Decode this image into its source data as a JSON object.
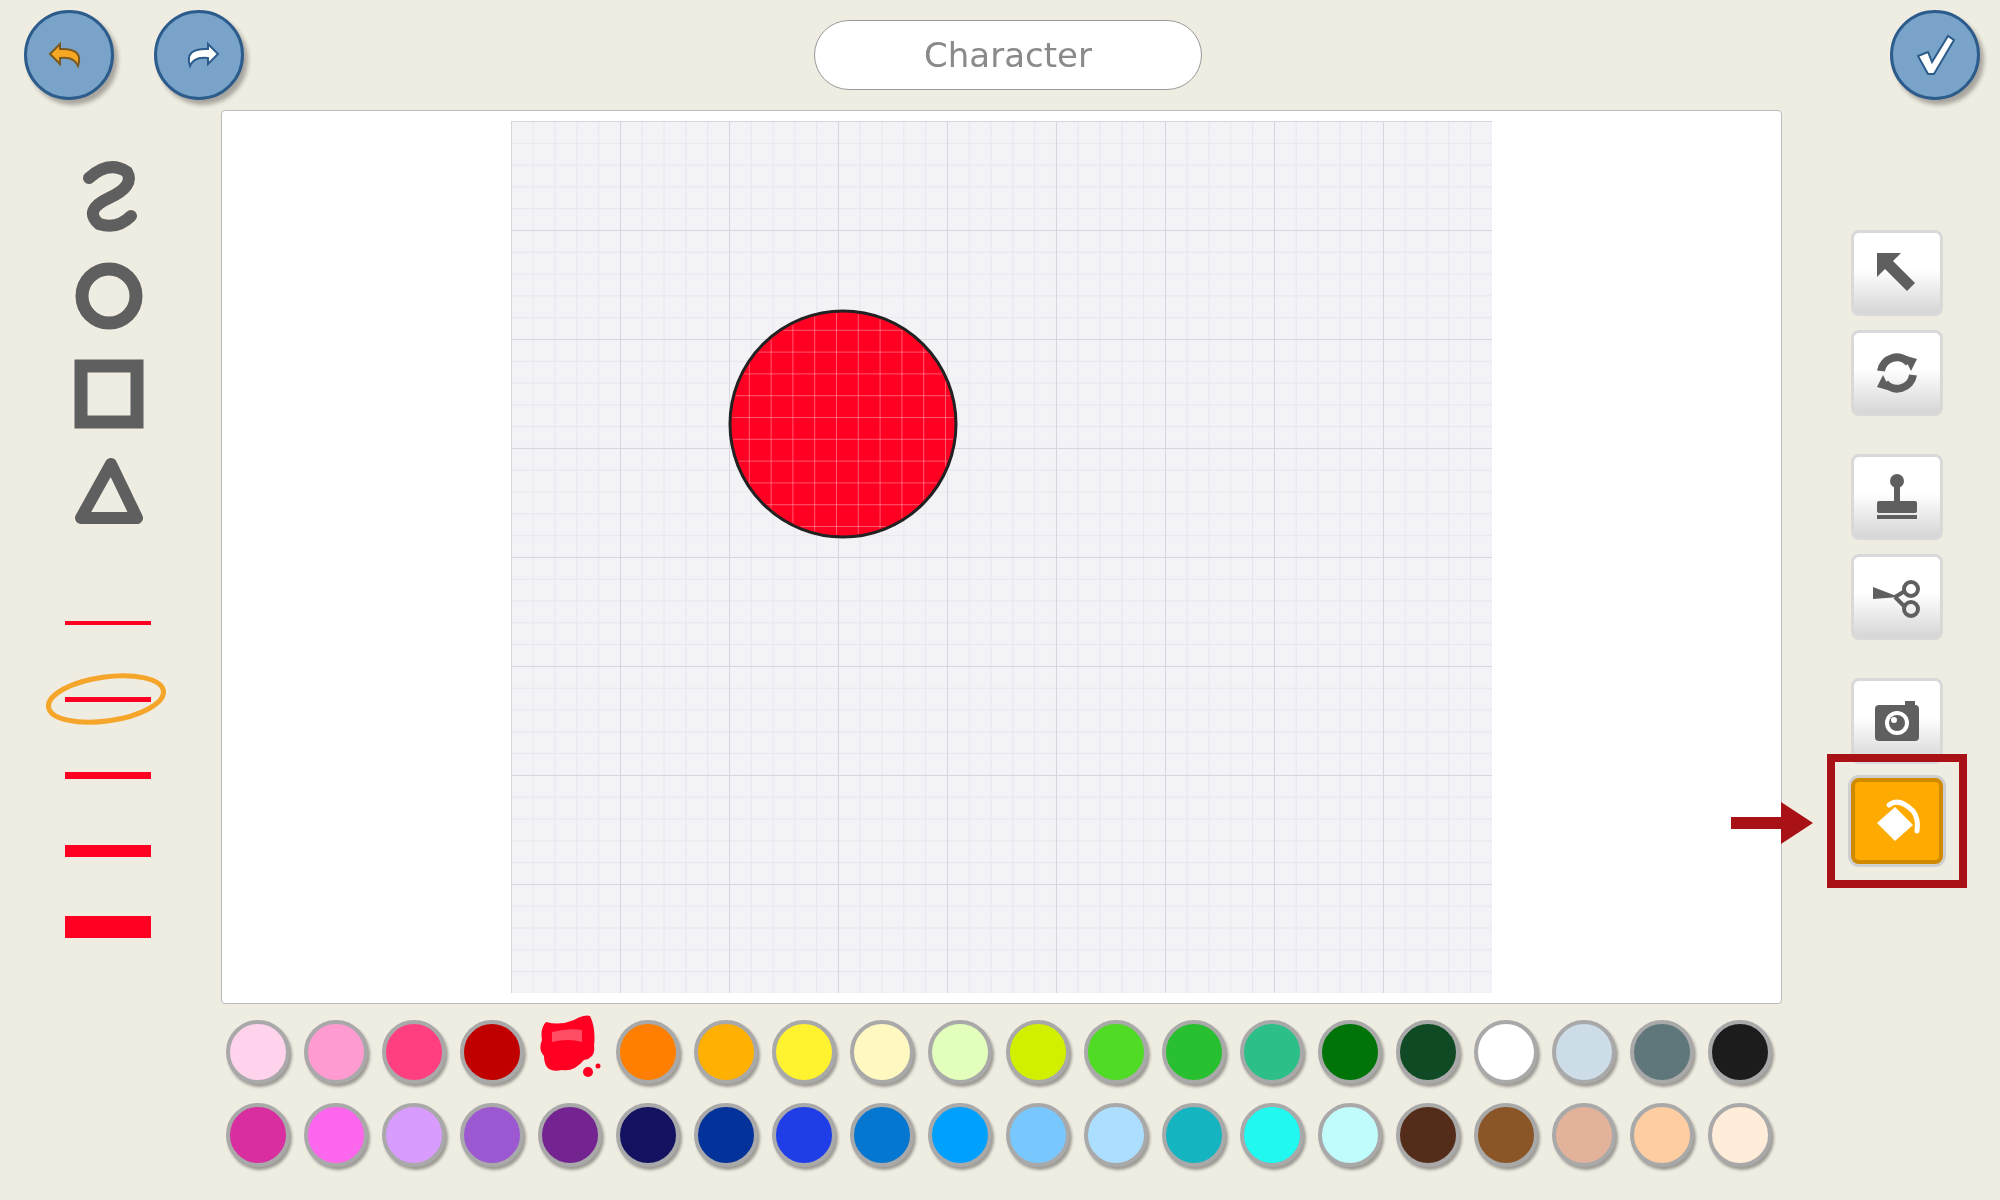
{
  "title_field": {
    "value": "Character"
  },
  "line_widths": [
    {
      "selected": false
    },
    {
      "selected": true
    },
    {
      "selected": false
    },
    {
      "selected": false
    },
    {
      "selected": false
    }
  ],
  "right_tools": [
    {
      "kind": "select",
      "selected": false,
      "highlighted": false
    },
    {
      "kind": "rotate",
      "selected": false,
      "highlighted": false
    },
    {
      "kind": "stamp",
      "selected": false,
      "highlighted": false
    },
    {
      "kind": "cut",
      "selected": false,
      "highlighted": false
    },
    {
      "kind": "camera",
      "selected": false,
      "highlighted": false
    },
    {
      "kind": "fill",
      "selected": true,
      "highlighted": true
    }
  ],
  "palette": [
    {
      "color": "#ffd3ec",
      "selected": false
    },
    {
      "color": "#ff9bd0",
      "selected": false
    },
    {
      "color": "#ff3f7f",
      "selected": false
    },
    {
      "color": "#c00000",
      "selected": false
    },
    {
      "color": "#ff0022",
      "selected": true
    },
    {
      "color": "#ff8000",
      "selected": false
    },
    {
      "color": "#ffb000",
      "selected": false
    },
    {
      "color": "#fff22f",
      "selected": false
    },
    {
      "color": "#fff8c0",
      "selected": false
    },
    {
      "color": "#e2ffbb",
      "selected": false
    },
    {
      "color": "#d0f000",
      "selected": false
    },
    {
      "color": "#50dc24",
      "selected": false
    },
    {
      "color": "#28c030",
      "selected": false
    },
    {
      "color": "#2cbf88",
      "selected": false
    },
    {
      "color": "#007408",
      "selected": false
    },
    {
      "color": "#0f4a24",
      "selected": false
    },
    {
      "color": "#ffffff",
      "selected": false
    },
    {
      "color": "#ccdde8",
      "selected": false
    },
    {
      "color": "#5f777a",
      "selected": false
    },
    {
      "color": "#1c1c1c",
      "selected": false
    },
    {
      "color": "#d82ea0",
      "selected": false
    },
    {
      "color": "#ff66ee",
      "selected": false
    },
    {
      "color": "#d89cff",
      "selected": false
    },
    {
      "color": "#9c58d0",
      "selected": false
    },
    {
      "color": "#742490",
      "selected": false
    },
    {
      "color": "#131260",
      "selected": false
    },
    {
      "color": "#02329a",
      "selected": false
    },
    {
      "color": "#1f3ee8",
      "selected": false
    },
    {
      "color": "#0677d0",
      "selected": false
    },
    {
      "color": "#00a0ff",
      "selected": false
    },
    {
      "color": "#78c8ff",
      "selected": false
    },
    {
      "color": "#acdfff",
      "selected": false
    },
    {
      "color": "#14b4c0",
      "selected": false
    },
    {
      "color": "#20f8f0",
      "selected": false
    },
    {
      "color": "#c0fcfc",
      "selected": false
    },
    {
      "color": "#532d1a",
      "selected": false
    },
    {
      "color": "#8a5628",
      "selected": false
    },
    {
      "color": "#e2b29b",
      "selected": false
    },
    {
      "color": "#fecda2",
      "selected": false
    },
    {
      "color": "#ffedda",
      "selected": false
    }
  ]
}
